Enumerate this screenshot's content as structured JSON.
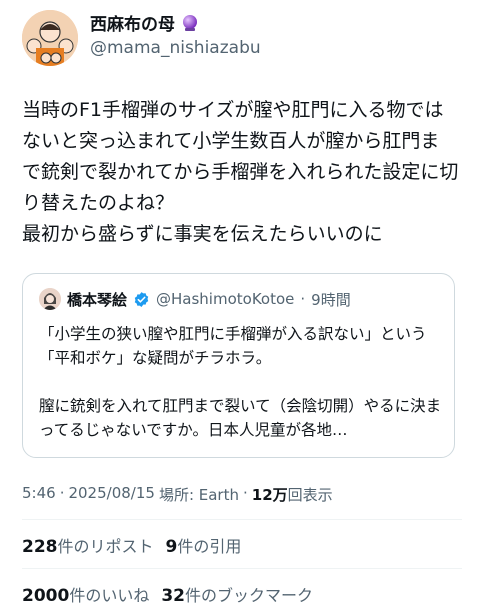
{
  "author": {
    "name": "西麻布の母",
    "handle": "@mama_nishiazabu"
  },
  "tweet": {
    "lines": [
      "当時のF1手榴弾のサイズが膣や肛門に入る物ではないと突っ込まれて小学生数百人が膣から肛門ま",
      "で銃剣で裂かれてから手榴弾を入れられた設定に切り替えたのよね？",
      "最初から盛らずに事実を伝えたらいいのに"
    ]
  },
  "quote": {
    "name": "橋本琴絵",
    "handle": "@HashimotoKotoe",
    "time": "9時間",
    "para1": "「小学生の狭い膣や肛門に手榴弾が入る訳ない」という「平和ボケ」な疑問がチラホラ。",
    "para2": "膣に銃剣を入れて肛門まで裂いて（会陰切開）やるに決まってるじゃないですか。日本人児童が各地…"
  },
  "meta": {
    "time": "5:46",
    "date": "2025/08/15",
    "location": "場所: Earth",
    "views_number": "12万",
    "views_label": "回表示"
  },
  "stats": {
    "reposts_number": "228",
    "reposts_label": "件のリポスト",
    "quotes_number": "9",
    "quotes_label": "件の引用",
    "likes_number": "2000",
    "likes_label": "件のいいね",
    "bookmarks_number": "32",
    "bookmarks_label": "件のブックマーク"
  },
  "colors": {
    "text": "#0f1419",
    "secondary": "#536471",
    "verified": "#1d9bf0",
    "border": "#cfd9de"
  }
}
